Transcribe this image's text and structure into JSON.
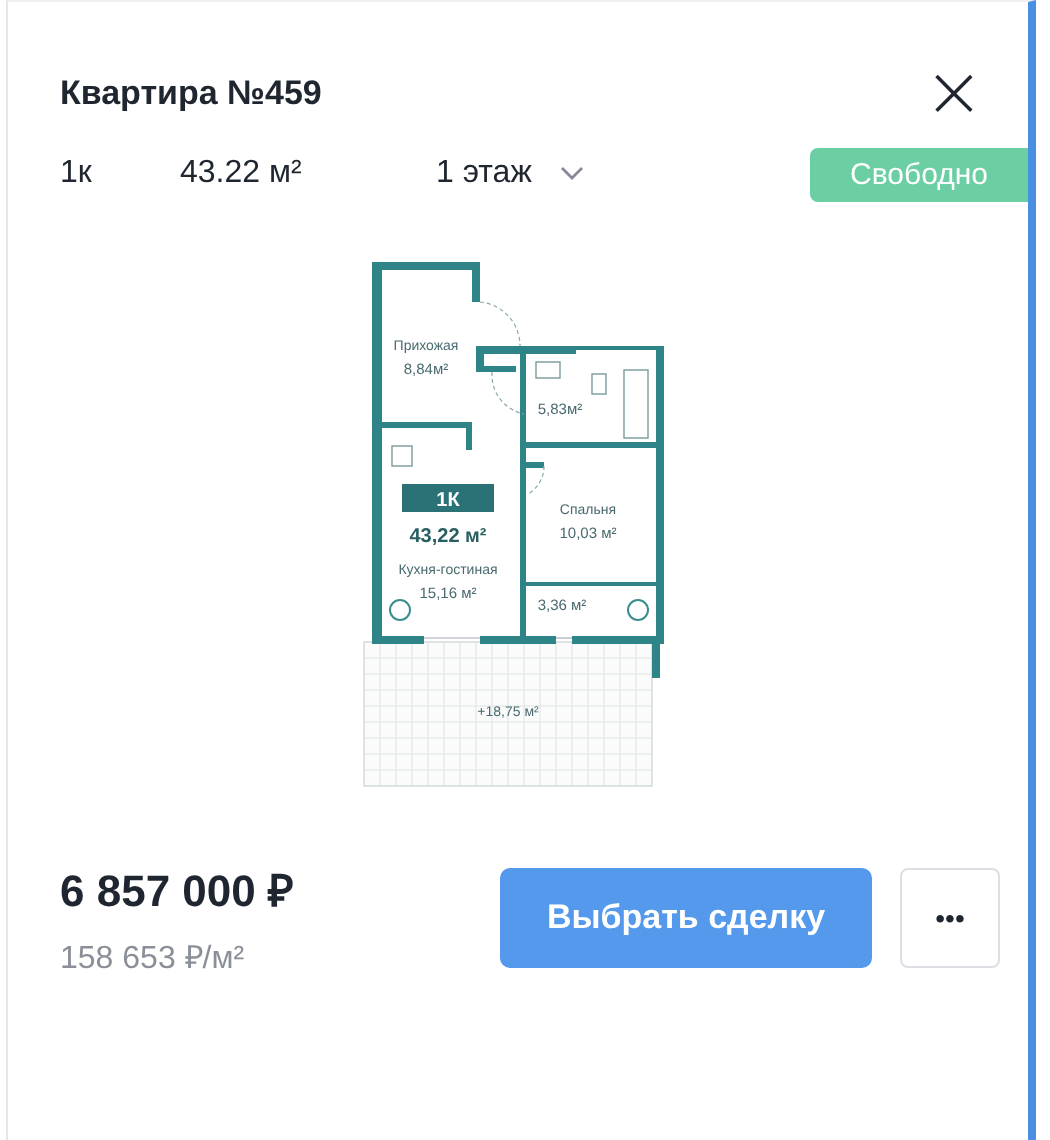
{
  "title": "Квартира №459",
  "close": {
    "label": "×"
  },
  "summary": {
    "rooms": "1к",
    "area": "43.22 м²",
    "floor": "1 этаж"
  },
  "status": {
    "label": "Свободно",
    "kind": "available"
  },
  "plan": {
    "unit_type": "1К",
    "total_area": "43,22 м²",
    "rooms": [
      {
        "kind": "hall",
        "name": "Прихожая",
        "area": "8,84м²"
      },
      {
        "kind": "bath",
        "area": "5,83м²"
      },
      {
        "kind": "kitchen",
        "name": "Кухня-гостиная",
        "area": "15,16 м²"
      },
      {
        "kind": "bedroom",
        "name": "Спальня",
        "area": "10,03 м²"
      },
      {
        "kind": "loggia",
        "area": "3,36 м²"
      }
    ],
    "balcony_area": "+18,75 м²"
  },
  "price": "6 857 000 ₽",
  "price_per_m2": "158 653 ₽/м²",
  "buttons": {
    "primary": "Выбрать сделку",
    "more": "•••"
  }
}
